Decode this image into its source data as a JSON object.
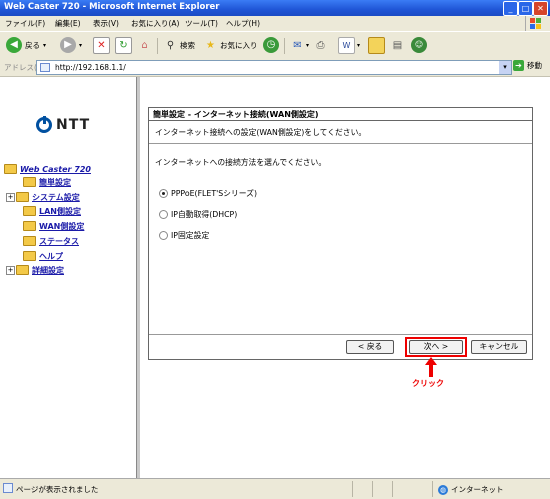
{
  "window": {
    "title": "Web Caster 720 - Microsoft Internet Explorer",
    "min": "_",
    "max": "□",
    "close": "✕"
  },
  "menu": [
    "ファイル(F)",
    "編集(E)",
    "表示(V)",
    "お気に入り(A)",
    "ツール(T)",
    "ヘルプ(H)"
  ],
  "toolbar": {
    "back": "戻る",
    "search": "検索",
    "favorites": "お気に入り"
  },
  "address": {
    "label": "アドレス(D)",
    "url": "http://192.168.1.1/",
    "go": "移動"
  },
  "logo": {
    "text": "NTT"
  },
  "tree": {
    "root": "Web Caster 720",
    "items": [
      {
        "label": "簡単設定",
        "expandable": false
      },
      {
        "label": "システム設定",
        "expandable": true
      },
      {
        "label": "LAN側設定",
        "expandable": false
      },
      {
        "label": "WAN側設定",
        "expandable": false
      },
      {
        "label": "ステータス",
        "expandable": false
      },
      {
        "label": "ヘルプ",
        "expandable": false
      },
      {
        "label": "詳細設定",
        "expandable": true
      }
    ]
  },
  "dialog": {
    "title": "簡単設定 - インターネット接続(WAN側設定)",
    "description": "インターネット接続への設定(WAN側設定)をしてください。",
    "prompt": "インターネットへの接続方法を選んでください。",
    "options": [
      {
        "label": "PPPoE(FLET'Sシリーズ)",
        "selected": true
      },
      {
        "label": "IP自動取得(DHCP)",
        "selected": false
      },
      {
        "label": "IP固定設定",
        "selected": false
      }
    ],
    "buttons": {
      "back": "< 戻る",
      "next": "次へ >",
      "cancel": "キャンセル"
    }
  },
  "annotation": {
    "label": "クリック",
    "color": "#e00000"
  },
  "status": {
    "text": "ページが表示されました",
    "zone": "インターネット"
  }
}
